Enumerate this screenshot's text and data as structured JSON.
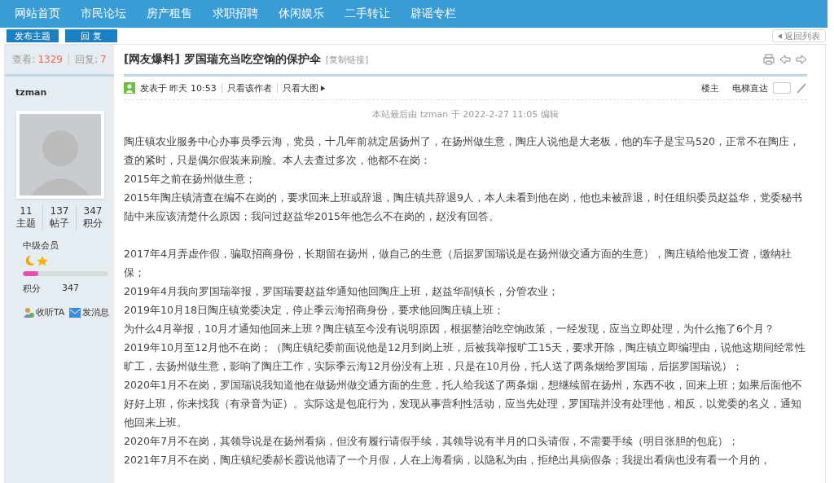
{
  "nav": {
    "items": [
      "网站首页",
      "市民论坛",
      "房产租售",
      "求职招聘",
      "休闲娱乐",
      "二手转让",
      "辟谣专栏"
    ]
  },
  "post_actions": {
    "new_thread": "发布主题",
    "reply": "回 复",
    "back": "返回列表"
  },
  "sidebar": {
    "views_label": "查看:",
    "views": "1329",
    "replies_label": "回复:",
    "replies": "7",
    "username": "tzman",
    "stats": [
      {
        "value": "11",
        "label": "主题"
      },
      {
        "value": "137",
        "label": "帖子"
      },
      {
        "value": "347",
        "label": "积分"
      }
    ],
    "rank": "中级会员",
    "level": 0.18,
    "points_label": "积分",
    "points": "347",
    "actions": [
      "收听TA",
      "发消息"
    ]
  },
  "post": {
    "title": "[网友爆料] 罗国瑞充当吃空饷的保护伞",
    "copy_link": "[复制链接]",
    "meta": {
      "posted": "发表于 昨天 10:53",
      "author_only": "只看该作者",
      "images_only": "只看大图",
      "floor": "楼主",
      "jump": "电梯直达"
    },
    "edit_note": "本站最后由 tzman 于 2022-2-27 11:05 编辑",
    "sections": [
      [
        "陶庄镇农业服务中心办事员季云海，党员，十几年前就定居扬州了，在扬州做生意，陶庄人说他是大老板，他的车子是宝马520，正常不在陶庄，查的紧时，只是偶尔假装来刷脸。本人去查过多次，他都不在岗：",
        "2015年之前在扬州做生意；",
        "2015年陶庄镇清查在编不在岗的，要求回来上班或辞退，陶庄镇共辞退9人，本人未看到他在岗，他也未被辞退，时任组织委员赵益华，党委秘书陆中来应该清楚什么原因；我问过赵益华2015年他怎么不在岗的，赵没有回答。"
      ],
      [
        "2017年4月弄虚作假，骗取招商身份，长期留在扬州，做自己的生意（后据罗国瑞说是在扬州做交通方面的生意），陶庄镇给他发工资，缴纳社保；",
        "2019年4月我向罗国瑞举报，罗国瑞要赵益华通知他回陶庄上班，赵益华副镇长，分管农业；",
        "2019年10月18日陶庄镇党委决定，停止季云海招商身份，要求他回陶庄镇上班；",
        "为什么4月举报，10月才通知他回来上班？陶庄镇至今没有说明原因，根据整治吃空饷政策，一经发现，应当立即处理，为什么拖了6个月？",
        "2019年10月至12月他不在岗；（陶庄镇纪委前面说他是12月到岗上班，后被我举报旷工15天，要求开除，陶庄镇立即编理由，说他这期间经常性旷工，去扬州做生意，影响了陶庄工作，实际季云海12月份没有上班，只是在10月份，托人送了两条烟给罗国瑞，后据罗国瑞说）；",
        "2020年1月不在岗，罗国瑞说我知道他在做扬州做交通方面的生意，托人给我送了两条烟，想继续留在扬州，东西不收，回来上班；如果后面他不好好上班，你来找我（有录音为证）。实际这是包庇行为，发现从事营利性活动，应当先处理，罗国瑞并没有处理他，相反，以党委的名义，通知他回来上班。",
        "2020年7月不在岗，其领导说是在扬州看病，但没有履行请假手续，其领导说有半月的口头请假，不需要手续（明目张胆的包庇）；",
        "2021年7月不在岗，陶庄镇纪委郝长霞说他请了一个月假，人在上海看病，以隐私为由，拒绝出具病假条；我提出看病也没有看一个月的，"
      ]
    ]
  }
}
